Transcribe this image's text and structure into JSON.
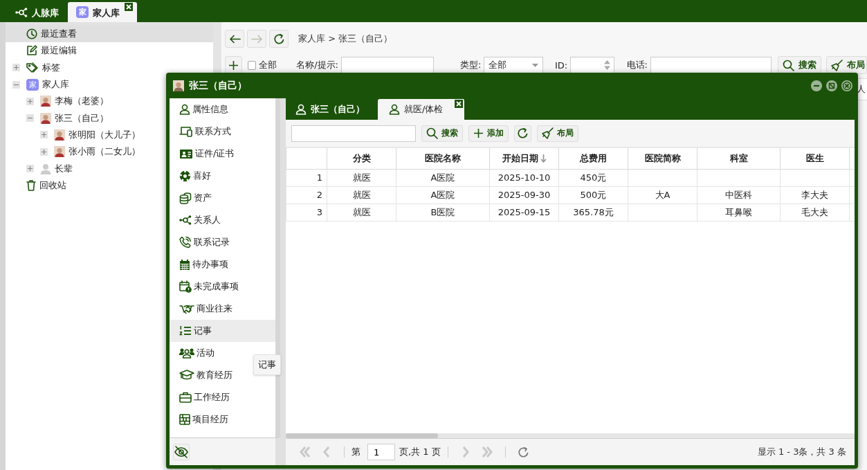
{
  "top_tabs": [
    {
      "label": "人脉库",
      "selected": false,
      "closable": false
    },
    {
      "badge": "家",
      "label": "家人库",
      "selected": true,
      "closable": true
    }
  ],
  "tree": [
    {
      "kind": "recent",
      "label": "最近查看",
      "selected": true
    },
    {
      "kind": "edited",
      "label": "最近编辑",
      "selected": false
    },
    {
      "kind": "tags",
      "label": "标签",
      "selected": false,
      "expanded": false
    },
    {
      "kind": "library",
      "badge": "家",
      "label": "家人库",
      "selected": false,
      "expanded": true,
      "children": [
        {
          "kind": "contact",
          "label": "李梅（老婆）",
          "selected": false,
          "expanded": false
        },
        {
          "kind": "contact",
          "label": "张三（自己）",
          "selected": false,
          "expanded": true,
          "children": [
            {
              "kind": "contact",
              "label": "张明阳（大儿子）",
              "selected": false,
              "expanded": false
            },
            {
              "kind": "contact",
              "label": "张小雨（二女儿）",
              "selected": false,
              "expanded": false
            }
          ]
        },
        {
          "kind": "group",
          "label": "长辈",
          "selected": false,
          "expanded": false
        }
      ]
    },
    {
      "kind": "trash",
      "label": "回收站",
      "selected": false
    }
  ],
  "nav_buttons": [
    {
      "kind": "back",
      "disabled": false
    },
    {
      "kind": "forward",
      "disabled": true
    },
    {
      "kind": "refresh",
      "disabled": false
    }
  ],
  "breadcrumb": "家人库 > 张三（自己）",
  "filter": {
    "select_all": {
      "label": "全部",
      "checked": false
    },
    "name_label": "名称/提示:",
    "type_label": "类型:",
    "type_value": "全部",
    "id_label": "ID:",
    "phone_label": "电话:",
    "search_button": "搜索",
    "layout_button": "布局"
  },
  "background_table": {
    "column_1": "人"
  },
  "dialog": {
    "title": "张三（自己）",
    "nav": [
      {
        "label": "属性信息",
        "selected": false
      },
      {
        "label": "联系方式",
        "selected": false
      },
      {
        "label": "证件/证书",
        "selected": false
      },
      {
        "label": "喜好",
        "selected": false
      },
      {
        "label": "资产",
        "selected": false
      },
      {
        "label": "关系人",
        "selected": false
      },
      {
        "label": "联系记录",
        "selected": false
      },
      {
        "label": "待办事项",
        "selected": false
      },
      {
        "label": "未完成事项",
        "selected": false
      },
      {
        "label": "商业往来",
        "selected": false
      },
      {
        "label": "记事",
        "selected": true
      },
      {
        "label": "活动",
        "selected": false
      },
      {
        "label": "教育经历",
        "selected": false
      },
      {
        "label": "工作经历",
        "selected": false
      },
      {
        "label": "项目经历",
        "selected": false
      }
    ],
    "tooltip": "记事",
    "tabs": [
      {
        "label": "张三（自己）",
        "selected": false,
        "closable": false
      },
      {
        "label": "就医/体检",
        "selected": true,
        "closable": true
      }
    ],
    "toolbar": {
      "search_button": "搜索",
      "add_button": "添加",
      "layout_button": "布局"
    },
    "table": {
      "columns": [
        {
          "label": "分类",
          "sorted": false
        },
        {
          "label": "医院名称",
          "sorted": false
        },
        {
          "label": "开始日期",
          "sorted": true
        },
        {
          "label": "总费用",
          "sorted": false
        },
        {
          "label": "医院简称",
          "sorted": false
        },
        {
          "label": "科室",
          "sorted": false
        },
        {
          "label": "医生",
          "sorted": false
        }
      ],
      "rows": [
        {
          "index": "1",
          "cells": [
            "就医",
            "A医院",
            "2025-10-10",
            "450元",
            null,
            null,
            null
          ]
        },
        {
          "index": "2",
          "cells": [
            "就医",
            "A医院",
            "2025-09-30",
            "500元",
            "大A",
            "中医科",
            "李大夫"
          ]
        },
        {
          "index": "3",
          "cells": [
            "就医",
            "B医院",
            "2025-09-15",
            "365.78元",
            null,
            "耳鼻喉",
            "毛大夫"
          ]
        }
      ]
    },
    "pager": {
      "buttons": [
        {
          "kind": "first",
          "disabled": true
        },
        {
          "kind": "prev",
          "disabled": true
        },
        {
          "kind": "next",
          "disabled": true
        },
        {
          "kind": "last",
          "disabled": true
        },
        {
          "kind": "refresh",
          "disabled": false
        }
      ],
      "page_prefix": "第",
      "page": "1",
      "page_suffix": "页,共 1 页",
      "summary": "显示 1 - 3条，共 3 条"
    }
  }
}
